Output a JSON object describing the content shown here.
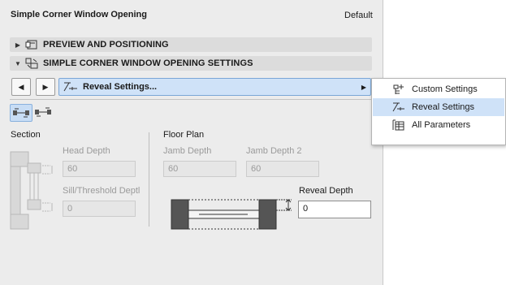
{
  "panel": {
    "title": "Simple Corner Window Opening",
    "default_label": "Default"
  },
  "sections": [
    {
      "label": "PREVIEW AND POSITIONING",
      "expanded": false,
      "icon": "preview-icon"
    },
    {
      "label": "SIMPLE CORNER WINDOW OPENING SETTINGS",
      "expanded": true,
      "icon": "window-settings-icon"
    }
  ],
  "nav": {
    "prev_icon": "triangle-left-icon",
    "next_icon": "triangle-right-icon"
  },
  "page_selector": {
    "value": "Reveal Settings...",
    "icon": "reveal-settings-icon"
  },
  "mode_icons": [
    {
      "icon": "reveal-type-1-icon",
      "selected": true
    },
    {
      "icon": "reveal-type-2-icon",
      "selected": false
    }
  ],
  "section_pane": {
    "heading": "Section",
    "head_depth": {
      "label": "Head Depth",
      "value": "60"
    },
    "sill_depth": {
      "label": "Sill/Threshold Deptl",
      "value": "0"
    }
  },
  "floor_plan_pane": {
    "heading": "Floor Plan",
    "jamb_depth": {
      "label": "Jamb Depth",
      "value": "60"
    },
    "jamb_depth_2": {
      "label": "Jamb Depth 2",
      "value": "60"
    },
    "reveal_depth": {
      "label": "Reveal Depth",
      "value": "0"
    }
  },
  "popup_menu": {
    "items": [
      {
        "label": "Custom Settings",
        "icon": "custom-settings-icon",
        "highlighted": false
      },
      {
        "label": "Reveal Settings",
        "icon": "reveal-settings-icon",
        "highlighted": true
      },
      {
        "label": "All Parameters",
        "icon": "all-parameters-icon",
        "highlighted": false
      }
    ]
  },
  "colors": {
    "panel_bg": "#ececec",
    "selection_blue": "#cfe2f8",
    "section_bar": "#dcdcdc"
  }
}
